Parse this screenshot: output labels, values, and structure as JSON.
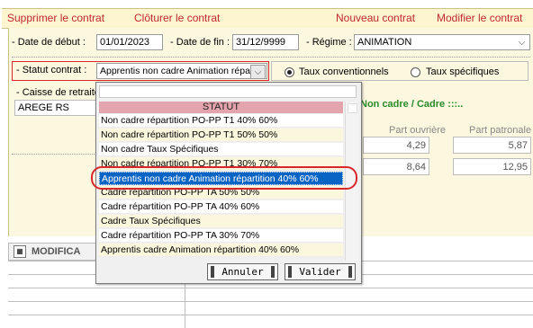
{
  "toolbar": {
    "delete": "Supprimer le contrat",
    "close": "Clôturer le contrat",
    "new": "Nouveau contrat",
    "edit": "Modifier le contrat"
  },
  "form": {
    "start_label": "- Date de début :",
    "start_value": "01/01/2023",
    "end_label": "- Date de fin :",
    "end_value": "31/12/9999",
    "regime_label": "- Régime :",
    "regime_value": "ANIMATION",
    "status_label": "- Statut contrat :",
    "status_value": "Apprentis non cadre Animation répar",
    "radio_conventional": "Taux conventionnels",
    "radio_specific": "Taux spécifiques",
    "caisse_label": "- Caisse de retraite",
    "caisse_value": "AREGE RS",
    "category_title": "Non cadre / Cadre :::..",
    "col_worker": "Part ouvrière",
    "col_employer": "Part patronale",
    "row1_worker": "4,29",
    "row1_employer": "5,87",
    "row2_worker": "8,64",
    "row2_employer": "12,95"
  },
  "bottom": {
    "tab_label": "MODIFICA"
  },
  "dropdown": {
    "header": "STATUT",
    "items": [
      "Non cadre répartition PO-PP T1 40% 60%",
      "Non cadre répartition PO-PP T1 50% 50%",
      "Non cadre Taux Spécifiques",
      "Non cadre répartition PO-PP T1 30% 70%",
      "Apprentis non cadre Animation répartition 40% 60%",
      "Cadre répartition PO-PP TA 50% 50%",
      "Cadre répartition PO-PP TA 40% 60%",
      "Cadre Taux Spécifiques",
      "Cadre répartition PO-PP TA 30% 70%",
      "Apprentis cadre Animation répartition 40% 60%"
    ],
    "cancel": "Annuler",
    "validate": "Valider"
  }
}
